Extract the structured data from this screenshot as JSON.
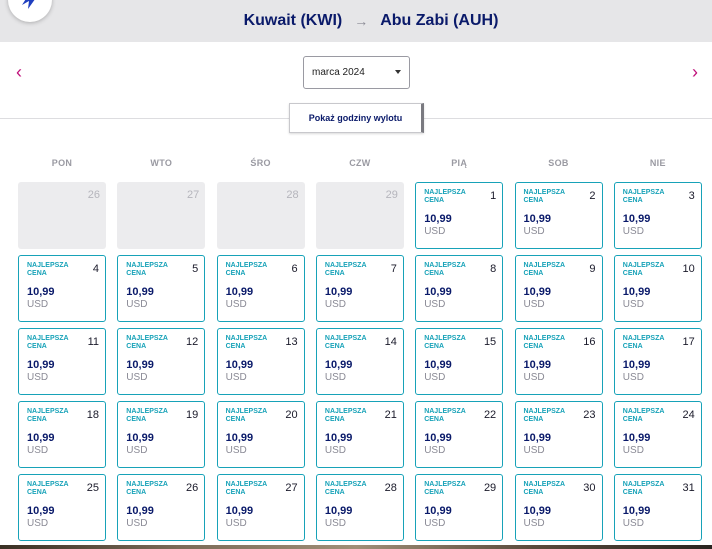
{
  "header": {
    "origin": "Kuwait (KWI)",
    "arrow": "→",
    "destination": "Abu Zabi (AUH)",
    "logo_icon": "airline-logo-icon"
  },
  "nav": {
    "prev_icon": "chevron-left-icon",
    "next_icon": "chevron-right-icon",
    "prev_glyph": "‹",
    "next_glyph": "›",
    "accent_color": "#c0107a"
  },
  "month_select": {
    "value": "marca 2024"
  },
  "hours_button": {
    "label": "Pokaż godziny wylotu"
  },
  "weekdays": [
    "PON",
    "WTO",
    "ŚRO",
    "CZW",
    "PIĄ",
    "SOB",
    "NIE"
  ],
  "colors": {
    "teal": "#17a2b8",
    "navy": "#0a1a6a"
  },
  "calendar": {
    "best_label": "NAJLEPSZA CENA",
    "days": [
      {
        "day": "26",
        "empty": true
      },
      {
        "day": "27",
        "empty": true
      },
      {
        "day": "28",
        "empty": true
      },
      {
        "day": "29",
        "empty": true
      },
      {
        "day": "1",
        "price": "10,99",
        "currency": "USD"
      },
      {
        "day": "2",
        "price": "10,99",
        "currency": "USD"
      },
      {
        "day": "3",
        "price": "10,99",
        "currency": "USD"
      },
      {
        "day": "4",
        "price": "10,99",
        "currency": "USD"
      },
      {
        "day": "5",
        "price": "10,99",
        "currency": "USD"
      },
      {
        "day": "6",
        "price": "10,99",
        "currency": "USD"
      },
      {
        "day": "7",
        "price": "10,99",
        "currency": "USD"
      },
      {
        "day": "8",
        "price": "10,99",
        "currency": "USD"
      },
      {
        "day": "9",
        "price": "10,99",
        "currency": "USD"
      },
      {
        "day": "10",
        "price": "10,99",
        "currency": "USD"
      },
      {
        "day": "11",
        "price": "10,99",
        "currency": "USD"
      },
      {
        "day": "12",
        "price": "10,99",
        "currency": "USD"
      },
      {
        "day": "13",
        "price": "10,99",
        "currency": "USD"
      },
      {
        "day": "14",
        "price": "10,99",
        "currency": "USD"
      },
      {
        "day": "15",
        "price": "10,99",
        "currency": "USD"
      },
      {
        "day": "16",
        "price": "10,99",
        "currency": "USD"
      },
      {
        "day": "17",
        "price": "10,99",
        "currency": "USD"
      },
      {
        "day": "18",
        "price": "10,99",
        "currency": "USD"
      },
      {
        "day": "19",
        "price": "10,99",
        "currency": "USD"
      },
      {
        "day": "20",
        "price": "10,99",
        "currency": "USD"
      },
      {
        "day": "21",
        "price": "10,99",
        "currency": "USD"
      },
      {
        "day": "22",
        "price": "10,99",
        "currency": "USD"
      },
      {
        "day": "23",
        "price": "10,99",
        "currency": "USD"
      },
      {
        "day": "24",
        "price": "10,99",
        "currency": "USD"
      },
      {
        "day": "25",
        "price": "10,99",
        "currency": "USD"
      },
      {
        "day": "26",
        "price": "10,99",
        "currency": "USD"
      },
      {
        "day": "27",
        "price": "10,99",
        "currency": "USD"
      },
      {
        "day": "28",
        "price": "10,99",
        "currency": "USD"
      },
      {
        "day": "29",
        "price": "10,99",
        "currency": "USD"
      },
      {
        "day": "30",
        "price": "10,99",
        "currency": "USD"
      },
      {
        "day": "31",
        "price": "10,99",
        "currency": "USD"
      }
    ]
  }
}
